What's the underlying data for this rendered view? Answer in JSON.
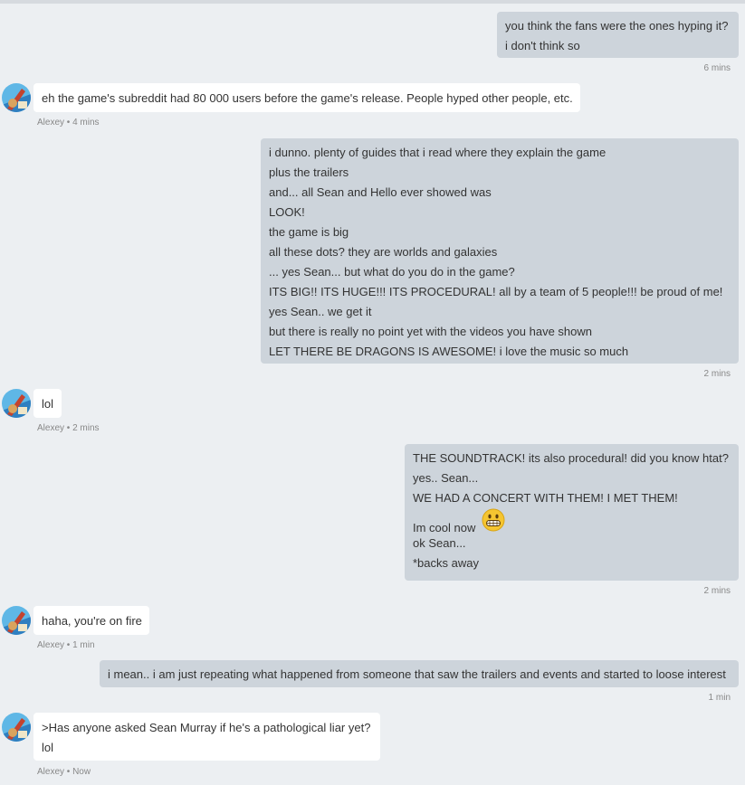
{
  "messages": [
    {
      "side": "out",
      "lines": [
        "you think the fans were the ones hyping it?",
        "i don't think so"
      ],
      "time": "6 mins"
    },
    {
      "side": "in",
      "lines": [
        "eh the game's subreddit had 80 000 users before the game's release. People hyped other people, etc."
      ],
      "meta": "Alexey • 4 mins"
    },
    {
      "side": "out",
      "lines": [
        "i dunno. plenty of guides that i read where they explain the game",
        "plus the trailers",
        "and... all Sean and Hello ever showed was",
        "LOOK!",
        "the game is big",
        "all these dots? they are worlds and galaxies",
        "... yes Sean... but what do you do in the game?",
        "ITS BIG!! ITS HUGE!!! ITS PROCEDURAL! all by a team of 5 people!!! be proud of me!",
        "yes Sean.. we get it",
        "but there is really no point yet with the videos you have shown",
        "LET THERE BE DRAGONS IS AWESOME! i love the music so much"
      ],
      "time": "2 mins"
    },
    {
      "side": "in",
      "lines": [
        "lol"
      ],
      "meta": "Alexey • 2 mins"
    },
    {
      "side": "out",
      "lines": [
        "THE SOUNDTRACK! its also procedural! did you know htat?",
        "yes.. Sean...",
        "WE HAD A CONCERT WITH THEM! I MET THEM!",
        "Im cool now",
        "ok Sean...",
        "*backs away"
      ],
      "emoji": "grinning-face-emoji",
      "time": "2 mins"
    },
    {
      "side": "in",
      "lines": [
        "haha, you're on fire"
      ],
      "meta": "Alexey • 1 min"
    },
    {
      "side": "out",
      "lines": [
        "i mean.. i am just repeating what happened from someone that saw the trailers and events and started to loose interest"
      ],
      "time": "1 min"
    },
    {
      "side": "in",
      "lines": [
        ">Has anyone asked Sean Murray if he's a pathological liar yet?",
        "lol"
      ],
      "meta": "Alexey • Now"
    }
  ],
  "colors": {
    "background": "#eceff2",
    "outgoing_bubble": "#cdd4db",
    "incoming_bubble": "#ffffff",
    "meta_text": "#888888"
  }
}
